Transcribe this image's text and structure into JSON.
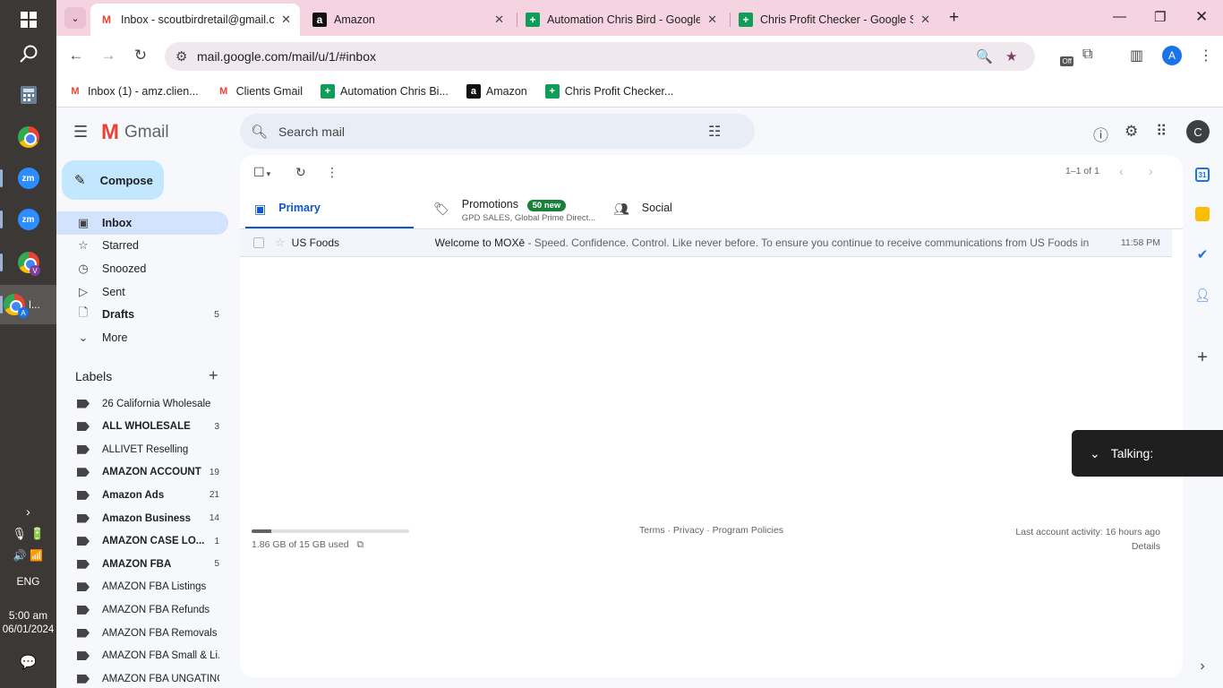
{
  "taskbar": {
    "time": "5:00 am",
    "date": "06/01/2024",
    "language": "ENG",
    "zoom1": "zm",
    "zoom2": "zm",
    "chrome_v": "V",
    "chrome_a": "A",
    "active_app_label": "l..."
  },
  "browser": {
    "tabs": [
      {
        "title": "Inbox - scoutbirdretail@gmail.c",
        "icon": "gmail-icon"
      },
      {
        "title": "Amazon",
        "icon": "amazon-icon"
      },
      {
        "title": "Automation Chris Bird - Google",
        "icon": "sheets-icon"
      },
      {
        "title": "Chris Profit Checker - Google S",
        "icon": "sheets-icon"
      }
    ],
    "url": "mail.google.com/mail/u/1/#inbox",
    "profile_initial": "A",
    "extension_badge": "Off",
    "bookmarks": [
      {
        "label": "Inbox (1) - amz.clien...",
        "icon": "gmail-icon"
      },
      {
        "label": "Clients Gmail",
        "icon": "gmail-icon"
      },
      {
        "label": "Automation Chris Bi...",
        "icon": "sheets-icon"
      },
      {
        "label": "Amazon",
        "icon": "amazon-icon"
      },
      {
        "label": "Chris Profit Checker...",
        "icon": "sheets-icon"
      }
    ]
  },
  "gmail": {
    "logo_text": "Gmail",
    "search_placeholder": "Search mail",
    "avatar_initial": "C",
    "compose_label": "Compose",
    "nav": [
      {
        "label": "Inbox",
        "icon": "inbox-icon",
        "count": ""
      },
      {
        "label": "Starred",
        "icon": "star-icon",
        "count": ""
      },
      {
        "label": "Snoozed",
        "icon": "clock-icon",
        "count": ""
      },
      {
        "label": "Sent",
        "icon": "send-icon",
        "count": ""
      },
      {
        "label": "Drafts",
        "icon": "draft-icon",
        "count": "5"
      },
      {
        "label": "More",
        "icon": "chevron-down-icon",
        "count": ""
      }
    ],
    "labels_title": "Labels",
    "labels": [
      {
        "name": "26 California Wholesale",
        "count": "",
        "bold": false
      },
      {
        "name": "ALL WHOLESALE",
        "count": "3",
        "bold": true
      },
      {
        "name": "ALLIVET Reselling",
        "count": "",
        "bold": false
      },
      {
        "name": "AMAZON ACCOUNT",
        "count": "19",
        "bold": true
      },
      {
        "name": "Amazon Ads",
        "count": "21",
        "bold": true
      },
      {
        "name": "Amazon Business",
        "count": "14",
        "bold": true
      },
      {
        "name": "AMAZON CASE LO...",
        "count": "1",
        "bold": true
      },
      {
        "name": "AMAZON FBA",
        "count": "5",
        "bold": true
      },
      {
        "name": "AMAZON FBA Listings",
        "count": "",
        "bold": false
      },
      {
        "name": "AMAZON FBA Refunds",
        "count": "",
        "bold": false
      },
      {
        "name": "AMAZON FBA Removals",
        "count": "",
        "bold": false
      },
      {
        "name": "AMAZON FBA Small & Li...",
        "count": "",
        "bold": false
      },
      {
        "name": "AMAZON FBA UNGATING",
        "count": "",
        "bold": false
      }
    ],
    "pager": "1–1 of 1",
    "tabs": {
      "primary": "Primary",
      "promotions": "Promotions",
      "promotions_badge": "50 new",
      "promotions_sub": "GPD SALES, Global Prime Direct...",
      "social": "Social"
    },
    "emails": [
      {
        "sender": "US Foods",
        "subject": "Welcome to MOXē",
        "snippet": " - Speed. Confidence. Control. Like never before. To ensure you continue to receive communications from US Foods in a time...",
        "time": "11:58 PM"
      }
    ],
    "storage": {
      "text": "1.86 GB of 15 GB used",
      "fraction": 0.124
    },
    "footer_links": "Terms · Privacy · Program Policies",
    "last_activity": "Last account activity: 16 hours ago",
    "details": "Details"
  },
  "overlay": {
    "talking_label": "Talking:"
  }
}
